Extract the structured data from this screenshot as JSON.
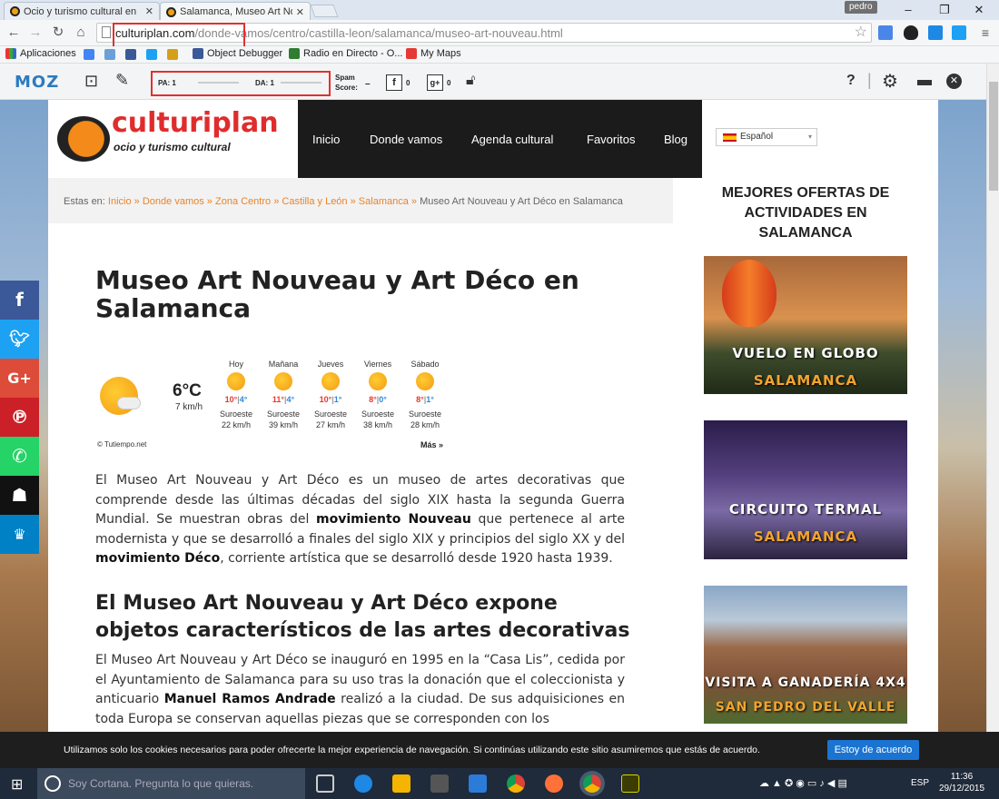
{
  "browser": {
    "tabs": [
      {
        "title": "Ocio y turismo cultural en"
      },
      {
        "title": "Salamanca, Museo Art No"
      }
    ],
    "user": "pedro",
    "window_buttons": [
      "–",
      "❐",
      "✕"
    ],
    "url_host": "culturiplan.com",
    "url_path": "/donde-vamos/centro/castilla-leon/salamanca/museo-art-nouveau.html",
    "bookmarks": [
      "Aplicaciones",
      "Object Debugger",
      "Radio en Directo - O...",
      "My Maps"
    ]
  },
  "mozbar": {
    "logo": "MOZ",
    "pa": "PA: 1",
    "da": "DA: 1",
    "spam_label_1": "Spam",
    "spam_label_2": "Score:",
    "spam_value": "–",
    "fb_count": "0",
    "gplus_count": "0"
  },
  "site": {
    "logo_main": "culturiplan",
    "logo_sub": "ocio y turismo cultural",
    "nav": [
      "Inicio",
      "Donde vamos",
      "Agenda cultural",
      "Favoritos",
      "Blog"
    ],
    "language": "Español",
    "breadcrumb": {
      "prefix": "Estas en:",
      "links": [
        "Inicio",
        "Donde vamos",
        "Zona Centro",
        "Castilla y León",
        "Salamanca"
      ],
      "sep": "»",
      "current": "Museo Art Nouveau y Art Déco en Salamanca"
    }
  },
  "article": {
    "title": "Museo Art Nouveau y Art Déco en Salamanca",
    "weather": {
      "current_temp": "6°C",
      "current_wind": "7 km/h",
      "credit": "© Tutiempo.net",
      "more": "Más »",
      "days": [
        {
          "day": "Hoy",
          "hi": "10°",
          "lo": "4°",
          "dir": "Suroeste",
          "wind": "22 km/h"
        },
        {
          "day": "Mañana",
          "hi": "11°",
          "lo": "4°",
          "dir": "Suroeste",
          "wind": "39 km/h"
        },
        {
          "day": "Jueves",
          "hi": "10°",
          "lo": "1°",
          "dir": "Suroeste",
          "wind": "27 km/h"
        },
        {
          "day": "Viernes",
          "hi": "8°",
          "lo": "0°",
          "dir": "Suroeste",
          "wind": "38 km/h"
        },
        {
          "day": "Sábado",
          "hi": "8°",
          "lo": "1°",
          "dir": "Suroeste",
          "wind": "28 km/h"
        }
      ]
    },
    "p1": {
      "a": "El Museo Art Nouveau y Art Déco es un museo de artes decorativas que comprende desde las últimas décadas del siglo XIX hasta la segunda Guerra Mundial. Se muestran obras del ",
      "b": "movimiento Nouveau",
      "c": " que pertenece al arte modernista y que se desarrolló a finales del siglo XIX y principios del siglo XX y del ",
      "d": "movimiento Déco",
      "e": ", corriente artística que se desarrolló desde 1920 hasta 1939."
    },
    "h2": "El Museo Art Nouveau y Art Déco expone objetos característicos de las artes decorativas",
    "p2": {
      "a": "El Museo Art Nouveau y Art Déco se inauguró en 1995 en la “Casa Lis”, cedida por el Ayuntamiento de Salamanca para su uso tras la donación que el coleccionista y anticuario ",
      "b": "Manuel Ramos Andrade",
      "c": " realizó a la ciudad. De sus adquisiciones en toda Europa se conservan aquellas piezas que se corresponden con los"
    }
  },
  "sidebar": {
    "title": "MEJORES OFERTAS DE ACTIVIDADES EN SALAMANCA",
    "ads": [
      {
        "line1": "VUELO EN GLOBO",
        "line2": "SALAMANCA"
      },
      {
        "line1": "CIRCUITO TERMAL",
        "line2": "SALAMANCA"
      },
      {
        "line1": "VISITA A GANADERÍA 4X4",
        "line2": "SAN PEDRO DEL VALLE"
      }
    ]
  },
  "social": [
    "f",
    "G+"
  ],
  "cookie": {
    "text": "Utilizamos solo los cookies necesarios para poder ofrecerte la mejor experiencia de navegación. Si continúas utilizando este sitio asumiremos que estás de acuerdo.",
    "button": "Estoy de acuerdo"
  },
  "taskbar": {
    "search_placeholder": "Soy Cortana. Pregunta lo que quieras.",
    "lang": "ESP",
    "time": "11:36",
    "date": "29/12/2015"
  },
  "colors": {
    "accent": "#f39a12",
    "link": "#e8842c",
    "cookie_btn": "#1b74d1"
  }
}
